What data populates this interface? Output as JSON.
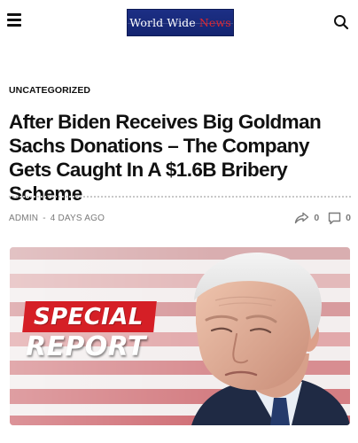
{
  "header": {
    "logo": {
      "part1": "World Wide ",
      "part2": "News"
    },
    "menu_icon": "hamburger-menu-icon",
    "search_icon": "search-icon"
  },
  "article": {
    "category": "UNCATEGORIZED",
    "title": "After Biden Receives Big Goldman Sachs Donations – The Company Gets Caught In A $1.6B Bribery Scheme",
    "author": "ADMIN",
    "separator": "-",
    "date": "4 DAYS AGO",
    "shares": "0",
    "comments": "0"
  },
  "featured_image": {
    "badge_line1": "SPECIAL",
    "badge_line2": "REPORT"
  },
  "colors": {
    "logo_bg": "#142470",
    "logo_accent": "#e0262e",
    "badge_red": "#d51f26",
    "meta_gray": "#7a7a7a"
  }
}
